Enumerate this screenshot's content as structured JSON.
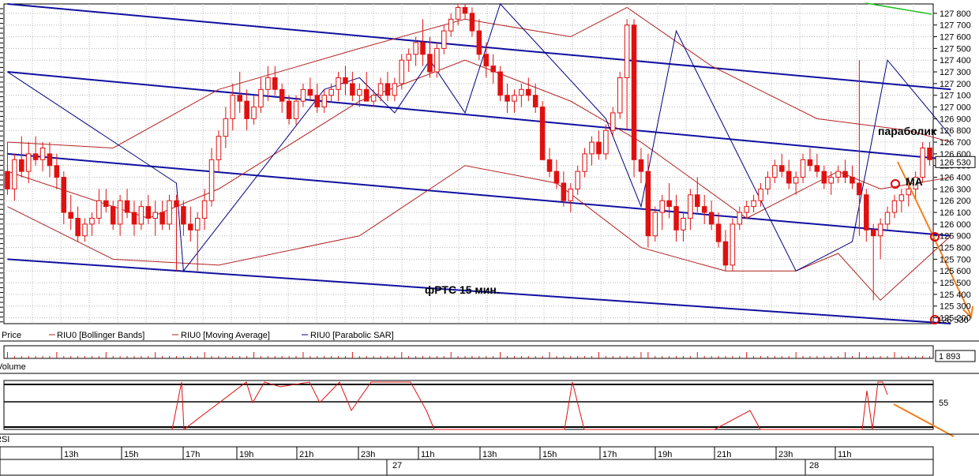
{
  "chart_data": {
    "type": "candlestick",
    "ylim": [
      125150,
      127880
    ],
    "price_ticks": [
      127800,
      127700,
      127600,
      127500,
      127400,
      127300,
      127200,
      127100,
      127000,
      126900,
      126800,
      126700,
      126600,
      126500,
      126400,
      126300,
      126200,
      126100,
      126000,
      125900,
      125800,
      125700,
      125600,
      125500,
      125400,
      125300,
      125200
    ],
    "price_tick_labels": [
      "127 800",
      "127 700",
      "127 600",
      "127 500",
      "127 400",
      "127 300",
      "127 200",
      "127 100",
      "127 000",
      "126 900",
      "126 800",
      "126 700",
      "126 600",
      "126 500",
      "126 400",
      "126 300",
      "126 200",
      "126 100",
      "126 000",
      "125 900",
      "125 800",
      "125 700",
      "125 600",
      "125 500",
      "125 400",
      "125 300",
      "125 200"
    ],
    "last_price": 126530,
    "last_price_label": "126 530",
    "legend": [
      {
        "label": "Price",
        "color": "#000000"
      },
      {
        "label": "RIU0 [Bollinger Bands]",
        "color": "#b22222"
      },
      {
        "label": "RIU0 [Moving Average]",
        "color": "#b22222"
      },
      {
        "label": "RIU0 [Parabolic SAR]",
        "color": "#000080"
      }
    ],
    "volume_label": "Volume",
    "volume_value_label": "1 893",
    "rsi_label": "RSI",
    "rsi_level_label": "55",
    "x_hour_labels": [
      "13h",
      "15h",
      "17h",
      "19h",
      "21h",
      "23h",
      "11h",
      "13h",
      "15h",
      "17h",
      "19h",
      "21h",
      "23h",
      "11h"
    ],
    "x_day_labels": [
      "27",
      "28"
    ],
    "annotations": {
      "chart_title": "фРТС   15 мин.",
      "parabolic_label": "параболик",
      "ma_label": "MA"
    },
    "colors": {
      "candle": "#e01010",
      "bands": "#b22222",
      "sar": "#000080",
      "channel": "#1010a0",
      "arrow": "#f08020",
      "marker": "#e00000",
      "green_line": "#20c020"
    },
    "candles": [
      [
        126450,
        126700,
        126250,
        126300
      ],
      [
        126300,
        126600,
        126200,
        126550
      ],
      [
        126550,
        126750,
        126400,
        126450
      ],
      [
        126450,
        126700,
        126350,
        126600
      ],
      [
        126600,
        126750,
        126500,
        126550
      ],
      [
        126550,
        126700,
        126450,
        126650
      ],
      [
        126600,
        126700,
        126400,
        126500
      ],
      [
        126500,
        126600,
        126300,
        126400
      ],
      [
        126400,
        126450,
        126000,
        126100
      ],
      [
        126100,
        126250,
        125950,
        126050
      ],
      [
        126050,
        126150,
        125850,
        125900
      ],
      [
        125900,
        126050,
        125850,
        126000
      ],
      [
        126000,
        126100,
        125900,
        126050
      ],
      [
        126050,
        126300,
        126000,
        126200
      ],
      [
        126200,
        126300,
        126100,
        126150
      ],
      [
        126150,
        126200,
        125950,
        126000
      ],
      [
        126000,
        126250,
        125900,
        126200
      ],
      [
        126200,
        126300,
        126050,
        126100
      ],
      [
        126100,
        126200,
        125900,
        126000
      ],
      [
        126000,
        126200,
        125950,
        126150
      ],
      [
        126150,
        126250,
        126000,
        126050
      ],
      [
        126050,
        126200,
        125900,
        126100
      ],
      [
        126100,
        126200,
        125950,
        126000
      ],
      [
        126000,
        126250,
        125950,
        126200
      ],
      [
        126200,
        126250,
        125600,
        126150
      ],
      [
        126150,
        126200,
        125900,
        126000
      ],
      [
        126000,
        126150,
        125850,
        125950
      ],
      [
        125950,
        126100,
        125600,
        126050
      ],
      [
        126050,
        126300,
        125950,
        126200
      ],
      [
        126200,
        126650,
        126150,
        126550
      ],
      [
        126550,
        126800,
        126450,
        126750
      ],
      [
        126750,
        127000,
        126650,
        126900
      ],
      [
        126900,
        127200,
        126800,
        127100
      ],
      [
        127100,
        127300,
        126950,
        127050
      ],
      [
        127050,
        127150,
        126800,
        126900
      ],
      [
        126900,
        127100,
        126850,
        127000
      ],
      [
        127000,
        127250,
        126950,
        127150
      ],
      [
        127150,
        127350,
        127050,
        127250
      ],
      [
        127250,
        127350,
        127100,
        127150
      ],
      [
        127150,
        127200,
        126950,
        127050
      ],
      [
        127050,
        127100,
        126850,
        126900
      ],
      [
        126900,
        127100,
        126850,
        127050
      ],
      [
        127050,
        127200,
        127000,
        127150
      ],
      [
        127150,
        127250,
        127050,
        127100
      ],
      [
        127100,
        127200,
        126950,
        127000
      ],
      [
        127000,
        127150,
        126950,
        127100
      ],
      [
        127100,
        127200,
        127050,
        127150
      ],
      [
        127150,
        127300,
        127050,
        127250
      ],
      [
        127250,
        127350,
        127100,
        127200
      ],
      [
        127200,
        127300,
        127050,
        127100
      ],
      [
        127100,
        127200,
        127000,
        127150
      ],
      [
        127150,
        127300,
        127050,
        127050
      ],
      [
        127050,
        127150,
        127000,
        127100
      ],
      [
        127100,
        127250,
        127050,
        127200
      ],
      [
        127200,
        127300,
        127050,
        127100
      ],
      [
        127100,
        127250,
        127050,
        127200
      ],
      [
        127200,
        127450,
        127150,
        127400
      ],
      [
        127400,
        127500,
        127300,
        127450
      ],
      [
        127450,
        127600,
        127350,
        127550
      ],
      [
        127550,
        127750,
        127350,
        127450
      ],
      [
        127450,
        127600,
        127250,
        127300
      ],
      [
        127300,
        127550,
        127250,
        127500
      ],
      [
        127500,
        127700,
        127450,
        127650
      ],
      [
        127650,
        127800,
        127600,
        127750
      ],
      [
        127750,
        127880,
        127700,
        127850
      ],
      [
        127850,
        127880,
        127750,
        127800
      ],
      [
        127800,
        127850,
        127600,
        127650
      ],
      [
        127650,
        127750,
        127400,
        127450
      ],
      [
        127450,
        127550,
        127250,
        127350
      ],
      [
        127350,
        127450,
        127200,
        127300
      ],
      [
        127300,
        127350,
        127050,
        127100
      ],
      [
        127100,
        127200,
        126950,
        127050
      ],
      [
        127050,
        127150,
        126950,
        127100
      ],
      [
        127100,
        127200,
        127000,
        127150
      ],
      [
        127150,
        127250,
        127050,
        127100
      ],
      [
        127100,
        127200,
        126950,
        127000
      ],
      [
        127000,
        127050,
        126800,
        126550
      ],
      [
        126550,
        126650,
        126400,
        126450
      ],
      [
        126450,
        126550,
        126300,
        126350
      ],
      [
        126350,
        126450,
        126150,
        126200
      ],
      [
        126200,
        126350,
        126100,
        126300
      ],
      [
        126300,
        126500,
        126250,
        126450
      ],
      [
        126450,
        126650,
        126400,
        126600
      ],
      [
        126600,
        126750,
        126500,
        126700
      ],
      [
        126700,
        126800,
        126550,
        126600
      ],
      [
        126600,
        126850,
        126550,
        126800
      ],
      [
        126800,
        127000,
        126750,
        126950
      ],
      [
        126950,
        127300,
        126900,
        127250
      ],
      [
        127250,
        127750,
        126800,
        127700
      ],
      [
        127700,
        127750,
        126400,
        126550
      ],
      [
        126550,
        126650,
        126350,
        126450
      ],
      [
        126450,
        126600,
        125800,
        125900
      ],
      [
        125900,
        126150,
        125850,
        126100
      ],
      [
        126100,
        126250,
        125950,
        126200
      ],
      [
        126200,
        126350,
        126050,
        126150
      ],
      [
        126150,
        126250,
        125850,
        125950
      ],
      [
        125950,
        126100,
        125850,
        126050
      ],
      [
        126050,
        126300,
        125950,
        126250
      ],
      [
        126250,
        126400,
        126100,
        126150
      ],
      [
        126150,
        126250,
        126000,
        126100
      ],
      [
        126100,
        126200,
        125950,
        126000
      ],
      [
        126000,
        126100,
        125800,
        125850
      ],
      [
        125850,
        125950,
        125600,
        125650
      ],
      [
        125650,
        126050,
        125600,
        126000
      ],
      [
        126000,
        126150,
        125950,
        126100
      ],
      [
        126100,
        126200,
        126050,
        126150
      ],
      [
        126150,
        126250,
        126100,
        126200
      ],
      [
        126200,
        126350,
        126150,
        126300
      ],
      [
        126300,
        126450,
        126250,
        126400
      ],
      [
        126400,
        126550,
        126350,
        126500
      ],
      [
        126500,
        126600,
        126400,
        126450
      ],
      [
        126450,
        126550,
        126300,
        126350
      ],
      [
        126350,
        126450,
        126250,
        126400
      ],
      [
        126400,
        126600,
        126350,
        126550
      ],
      [
        126550,
        126650,
        126450,
        126500
      ],
      [
        126500,
        126600,
        126400,
        126450
      ],
      [
        126450,
        126500,
        126300,
        126350
      ],
      [
        126350,
        126450,
        126250,
        126400
      ],
      [
        126400,
        126500,
        126350,
        126450
      ],
      [
        126450,
        126550,
        126350,
        126400
      ],
      [
        126400,
        126500,
        126300,
        126350
      ],
      [
        126350,
        127400,
        125900,
        126250
      ],
      [
        126250,
        126300,
        125850,
        125950
      ],
      [
        125950,
        126000,
        125350,
        125900
      ],
      [
        125900,
        126050,
        125700,
        126000
      ],
      [
        126000,
        126150,
        125950,
        126100
      ],
      [
        126100,
        126250,
        126050,
        126200
      ],
      [
        126200,
        126300,
        126100,
        126250
      ],
      [
        126250,
        126400,
        126150,
        126300
      ],
      [
        126300,
        126450,
        126200,
        126400
      ],
      [
        126400,
        126700,
        126350,
        126650
      ],
      [
        126650,
        126700,
        126500,
        126550
      ]
    ],
    "bollinger_upper": [
      [
        0,
        126700
      ],
      [
        15,
        126650
      ],
      [
        30,
        127150
      ],
      [
        50,
        127500
      ],
      [
        65,
        127750
      ],
      [
        80,
        127600
      ],
      [
        88,
        127850
      ],
      [
        100,
        127350
      ],
      [
        115,
        126900
      ],
      [
        128,
        126800
      ],
      [
        134,
        126700
      ]
    ],
    "bollinger_lower": [
      [
        0,
        126150
      ],
      [
        15,
        125700
      ],
      [
        30,
        125650
      ],
      [
        50,
        125900
      ],
      [
        65,
        126500
      ],
      [
        78,
        126350
      ],
      [
        90,
        125800
      ],
      [
        102,
        125600
      ],
      [
        112,
        125600
      ],
      [
        118,
        125750
      ],
      [
        124,
        125350
      ],
      [
        134,
        125900
      ]
    ],
    "moving_average": [
      [
        0,
        126450
      ],
      [
        20,
        126050
      ],
      [
        30,
        126300
      ],
      [
        50,
        127050
      ],
      [
        65,
        127400
      ],
      [
        80,
        127050
      ],
      [
        90,
        126700
      ],
      [
        105,
        126050
      ],
      [
        118,
        126450
      ],
      [
        124,
        126300
      ],
      [
        134,
        126400
      ]
    ],
    "parabolic_sar": [
      [
        0,
        127300
      ],
      [
        24,
        126350
      ],
      [
        25,
        125600
      ],
      [
        45,
        127150
      ],
      [
        50,
        127250
      ],
      [
        55,
        126950
      ],
      [
        60,
        127400
      ],
      [
        65,
        126950
      ],
      [
        70,
        127880
      ],
      [
        85,
        126900
      ],
      [
        90,
        126150
      ],
      [
        95,
        127650
      ],
      [
        112,
        125600
      ],
      [
        120,
        125850
      ],
      [
        125,
        127400
      ],
      [
        134,
        126750
      ]
    ],
    "channel_lines": [
      [
        [
          0,
          127880
        ],
        [
          134,
          127150
        ]
      ],
      [
        [
          0,
          127300
        ],
        [
          134,
          126550
        ]
      ],
      [
        [
          0,
          126600
        ],
        [
          134,
          125900
        ]
      ],
      [
        [
          0,
          125700
        ],
        [
          134,
          125150
        ]
      ]
    ]
  }
}
